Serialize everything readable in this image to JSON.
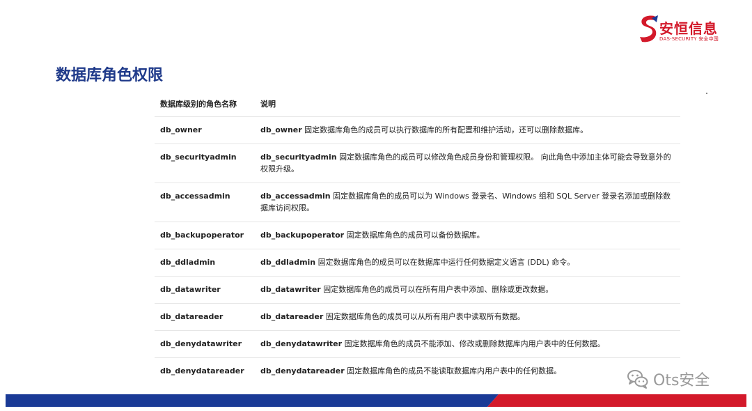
{
  "brand": {
    "name": "安恒信息",
    "subtitle": "DAS-SECURITY 安全中国",
    "icon": "s-logo-icon",
    "red": "#d3192a",
    "navy": "#1a3a96"
  },
  "page": {
    "title": "数据库角色权限",
    "title_color": "#1f3a8a"
  },
  "table": {
    "headers": [
      "数据库级别的角色名称",
      "说明"
    ],
    "rows": [
      {
        "role": "db_owner",
        "desc_role": "db_owner",
        "desc": " 固定数据库角色的成员可以执行数据库的所有配置和维护活动，还可以删除数据库。"
      },
      {
        "role": "db_securityadmin",
        "desc_role": "db_securityadmin",
        "desc": " 固定数据库角色的成员可以修改角色成员身份和管理权限。 向此角色中添加主体可能会导致意外的权限升级。"
      },
      {
        "role": "db_accessadmin",
        "desc_role": "db_accessadmin",
        "desc": " 固定数据库角色的成员可以为 Windows 登录名、Windows 组和 SQL Server 登录名添加或删除数据库访问权限。"
      },
      {
        "role": "db_backupoperator",
        "desc_role": "db_backupoperator",
        "desc": " 固定数据库角色的成员可以备份数据库。"
      },
      {
        "role": "db_ddladmin",
        "desc_role": "db_ddladmin",
        "desc": " 固定数据库角色的成员可以在数据库中运行任何数据定义语言 (DDL) 命令。"
      },
      {
        "role": "db_datawriter",
        "desc_role": "db_datawriter",
        "desc": " 固定数据库角色的成员可以在所有用户表中添加、删除或更改数据。"
      },
      {
        "role": "db_datareader",
        "desc_role": "db_datareader",
        "desc": " 固定数据库角色的成员可以从所有用户表中读取所有数据。"
      },
      {
        "role": "db_denydatawriter",
        "desc_role": "db_denydatawriter",
        "desc": " 固定数据库角色的成员不能添加、修改或删除数据库内用户表中的任何数据。"
      },
      {
        "role": "db_denydatareader",
        "desc_role": "db_denydatareader",
        "desc": " 固定数据库角色的成员不能读取数据库内用户表中的任何数据。"
      }
    ]
  },
  "watermark": {
    "text": "Ots安全",
    "icon": "wechat-icon"
  }
}
